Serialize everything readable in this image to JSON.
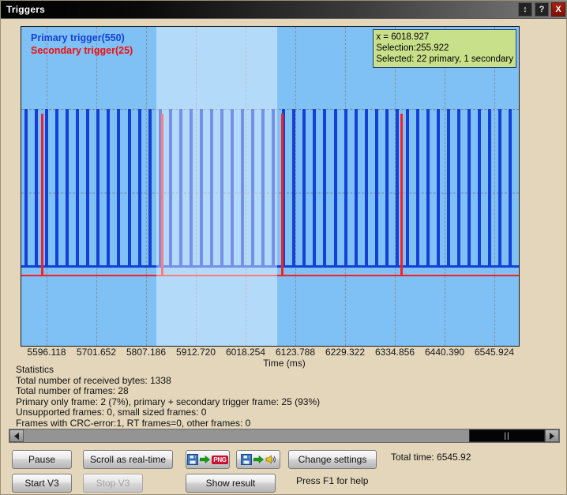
{
  "window": {
    "title": "Triggers",
    "buttons": [
      {
        "name": "restore-button",
        "label": "↕"
      },
      {
        "name": "help-button",
        "label": "?"
      },
      {
        "name": "close-button",
        "label": "X"
      }
    ]
  },
  "chart_data": {
    "type": "line",
    "title": "",
    "xlabel": "Time (ms)",
    "ylabel": "",
    "xlim": [
      5543.351,
      6598.691
    ],
    "grid": true,
    "legend_position": "top-left",
    "legend": [
      {
        "label": "Primary trigger(550)",
        "color": "#1540d6"
      },
      {
        "label": "Secondary trigger(25)",
        "color": "#f40d0d"
      }
    ],
    "xticks": [
      "5596.118",
      "5701.652",
      "5807.186",
      "5912.720",
      "6018.254",
      "6123.788",
      "6229.322",
      "6334.856",
      "6440.390",
      "6545.924"
    ],
    "series": [
      {
        "name": "Primary trigger",
        "color": "#1540d6",
        "count": 550,
        "kind": "pulse-train"
      },
      {
        "name": "Secondary trigger",
        "color": "#fb2020",
        "count": 25,
        "kind": "pulse-spikes"
      }
    ],
    "selection": {
      "start_ms": 5830.0,
      "end_ms": 6085.9,
      "width_ms": 255.922
    },
    "cursor": {
      "x_ms": 6018.927
    }
  },
  "infobox": {
    "cursor_line": "x = 6018.927",
    "selection_line": "Selection:255.922",
    "selected_line": "Selected: 22 primary, 1 secondary",
    "bg": "#c9e08a"
  },
  "axis": {
    "title": "Time (ms)"
  },
  "statistics": {
    "heading": "Statistics",
    "lines": [
      "Total number of received bytes: 1338",
      "Total number of frames: 28",
      "Primary only frame: 2 (7%), primary + secondary trigger frame: 25 (93%)",
      "Unsupported frames: 0, small sized frames: 0",
      "Frames with CRC-error:1, RT frames=0, other frames: 0"
    ]
  },
  "scrollbar": {
    "left_arrow": "◀",
    "right_arrow": "▶",
    "thumb_grip": "||"
  },
  "controls": {
    "pause": "Pause",
    "scroll_realtime": "Scroll as real-time",
    "save_png": "PNG",
    "save_audio": "audio",
    "change_settings": "Change settings",
    "start_v3": "Start V3",
    "stop_v3": "Stop V3",
    "show_result": "Show result",
    "total_time": "Total time: 6545.92",
    "help_hint": "Press F1 for help"
  }
}
